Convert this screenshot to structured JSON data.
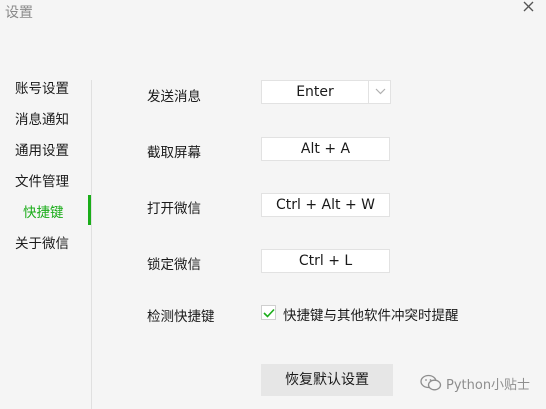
{
  "window": {
    "title": "设置"
  },
  "sidebar": {
    "items": [
      {
        "label": "账号设置"
      },
      {
        "label": "消息通知"
      },
      {
        "label": "通用设置"
      },
      {
        "label": "文件管理"
      },
      {
        "label": "快捷键",
        "active": true
      },
      {
        "label": "关于微信"
      }
    ]
  },
  "shortcuts": {
    "send_message": {
      "label": "发送消息",
      "value": "Enter"
    },
    "screenshot": {
      "label": "截取屏幕",
      "value": "Alt + A"
    },
    "open_wechat": {
      "label": "打开微信",
      "value": "Ctrl + Alt + W"
    },
    "lock_wechat": {
      "label": "锁定微信",
      "value": "Ctrl + L"
    },
    "detect": {
      "label": "检测快捷键",
      "checkbox_label": "快捷键与其他软件冲突时提醒",
      "checked": true
    },
    "reset_label": "恢复默认设置"
  },
  "watermark": {
    "text": "Python小贴士"
  },
  "colors": {
    "accent": "#1aad19",
    "background": "#f5f5f5",
    "button": "#e6e6e6"
  },
  "icons": {
    "close": "close-icon",
    "dropdown": "chevron-down-icon",
    "check": "check-icon",
    "watermark": "wechat-logo-icon"
  }
}
